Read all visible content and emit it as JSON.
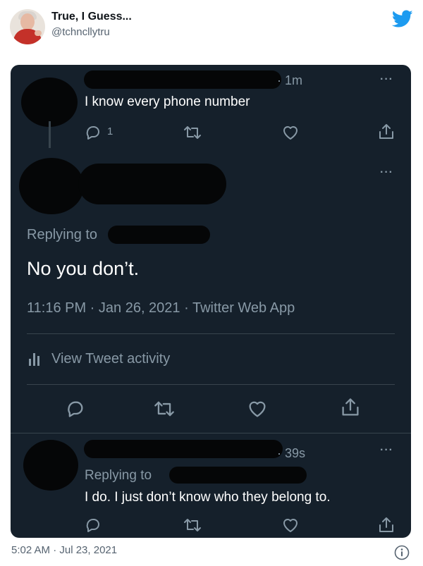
{
  "header": {
    "name": "True, I Guess...",
    "handle": "@tchncllytru",
    "twitter_icon": "twitter-bird-icon"
  },
  "card": {
    "tweet1": {
      "time": "· 1m",
      "text": "I know every phone number",
      "reply_count": "1"
    },
    "main": {
      "replying_label": "Replying to",
      "text": "No you don’t.",
      "meta": "11:16 PM · Jan 26, 2021 · Twitter Web App",
      "activity_label": "View Tweet activity"
    },
    "reply": {
      "time": "· 39s",
      "replying_label": "Replying to",
      "text": "I do. I just don’t know who they belong to."
    },
    "more_label": "···"
  },
  "footer": {
    "timestamp": "5:02 AM · Jul 23, 2021"
  },
  "colors": {
    "card_bg": "#15202b",
    "twitter_blue": "#1d9bf0",
    "gray_text": "#8899a6"
  }
}
